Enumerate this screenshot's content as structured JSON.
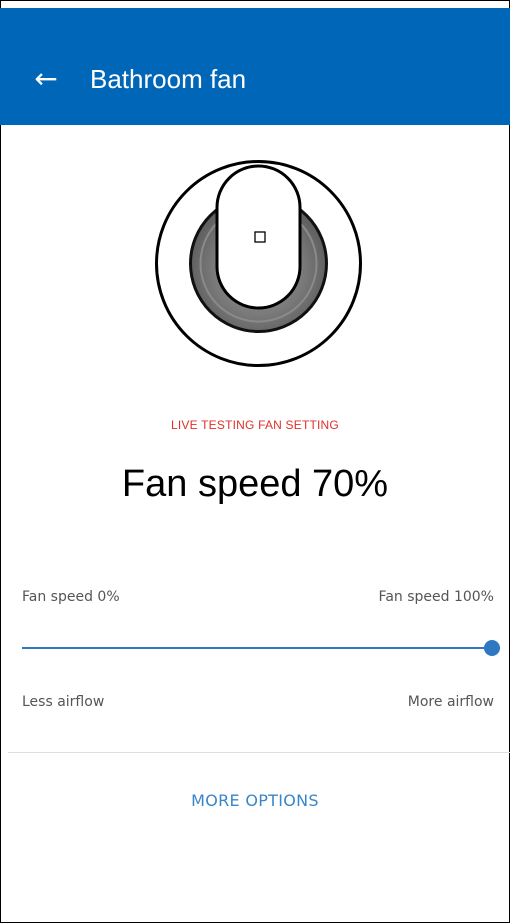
{
  "header": {
    "back_icon": "arrow-left-icon",
    "back_glyph": "←",
    "title": "Bathroom fan"
  },
  "device": {
    "icon": "fan-switch-icon"
  },
  "status": {
    "live_label": "LIVE TESTING FAN SETTING",
    "speed_readout": "Fan speed 70%"
  },
  "slider": {
    "min_label": "Fan speed 0%",
    "max_label": "Fan speed 100%",
    "left_caption": "Less airflow",
    "right_caption": "More airflow",
    "value_fraction": 1.0
  },
  "actions": {
    "more_options": "MORE OPTIONS"
  },
  "colors": {
    "header_bg": "#0066b8",
    "accent": "#2e78c2",
    "live_label": "#e0302a",
    "link": "#3a86c8"
  }
}
